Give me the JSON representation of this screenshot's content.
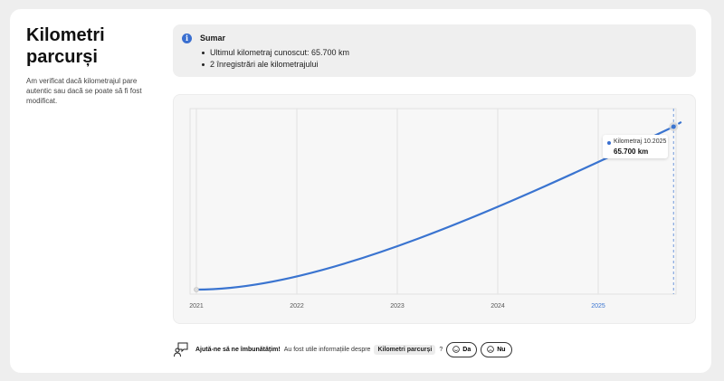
{
  "header": {
    "title_line1": "Kilometri",
    "title_line2": "parcurși",
    "description": "Am verificat dacă kilometrajul pare autentic sau dacă se poate să fi fost modificat."
  },
  "summary": {
    "icon": "info-icon",
    "title": "Sumar",
    "items": [
      "Ultimul kilometraj cunoscut: 65.700 km",
      "2 înregistrări ale kilometrajului"
    ]
  },
  "chart_data": {
    "type": "line",
    "x": [
      "2021",
      "2025-10"
    ],
    "x_ticks": [
      "2021",
      "2022",
      "2023",
      "2024",
      "2025"
    ],
    "highlight_tick": "2025",
    "series": [
      {
        "values": [
          0,
          65700
        ]
      }
    ],
    "xlabel": "",
    "ylabel": "",
    "grid": true,
    "line_color": "#3a74d0",
    "tooltip": {
      "label": "Kilometraj 10.2025",
      "value": "65.700 km"
    }
  },
  "feedback": {
    "icon": "chat-feedback-icon",
    "prompt_bold": "Ajută-ne să ne îmbunătățim!",
    "question": "Au fost utile informațiile despre",
    "topic": "Kilometri parcurși",
    "question_mark": "?",
    "yes_label": "Da",
    "no_label": "Nu"
  },
  "colors": {
    "accent": "#3a6fd0",
    "background": "#eeeeee",
    "card": "#ffffff"
  }
}
